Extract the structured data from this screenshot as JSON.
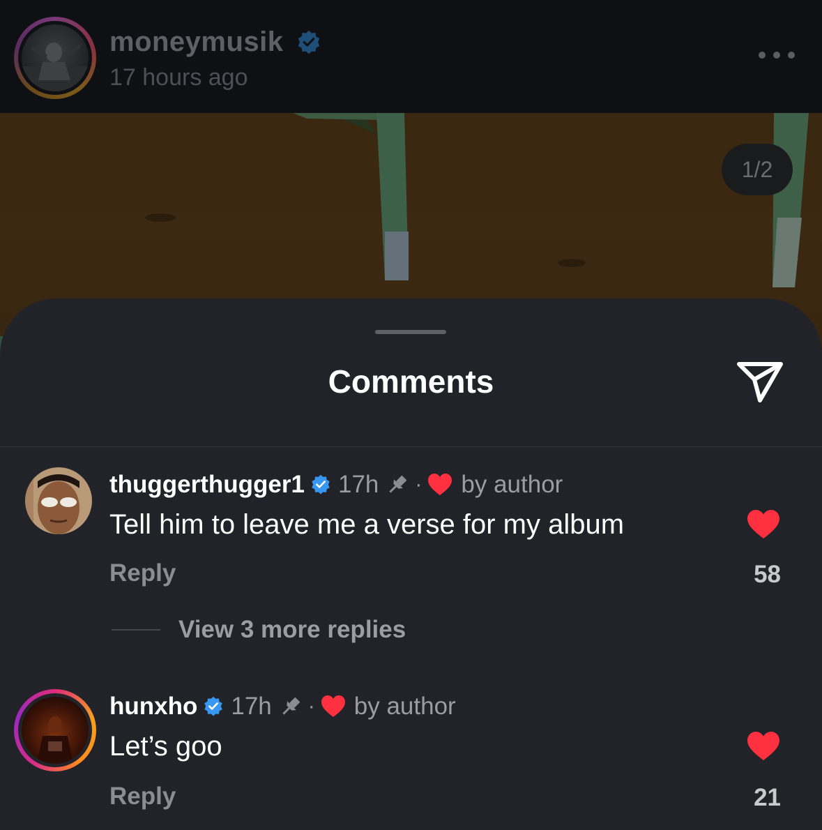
{
  "post": {
    "username": "moneymusik",
    "time_ago": "17 hours ago",
    "page_counter": "1/2"
  },
  "comments_sheet": {
    "title": "Comments",
    "comments": [
      {
        "username": "thuggerthugger1",
        "age": "17h",
        "separator": "·",
        "author_label": "by author",
        "text": "Tell him to leave me a verse for my album",
        "reply_label": "Reply",
        "likes": "58",
        "view_replies": "View 3 more replies"
      },
      {
        "username": "hunxho",
        "age": "17h",
        "separator": "·",
        "author_label": "by author",
        "text": "Let’s goo",
        "reply_label": "Reply",
        "likes": "21"
      }
    ]
  },
  "colors": {
    "sheet_background": "#212328",
    "verified_badge": "#3897f0",
    "heart": "#ff3040",
    "text_primary": "#ffffff",
    "text_secondary": "#9a9da3"
  },
  "icons": [
    "verified-badge-icon",
    "more-options-icon",
    "share-icon",
    "pin-icon",
    "heart-icon"
  ]
}
